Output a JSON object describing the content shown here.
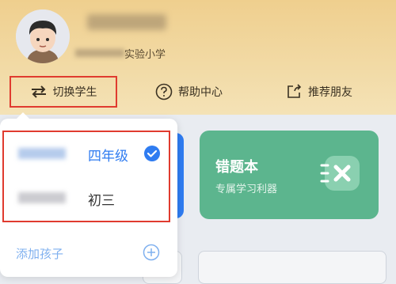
{
  "header": {
    "school_suffix": "实验小学",
    "actions": {
      "switch_label": "切换学生",
      "help_label": "帮助中心",
      "share_label": "推荐朋友"
    }
  },
  "cards": {
    "wrong_book": {
      "title": "错题本",
      "subtitle": "专属学习利器"
    }
  },
  "dropdown": {
    "students": [
      {
        "grade": "四年级",
        "selected": true
      },
      {
        "grade": "初三",
        "selected": false
      }
    ],
    "add_child_label": "添加孩子"
  },
  "colors": {
    "accent_blue": "#2f7cf1",
    "highlight_red": "#e03b2f",
    "card_green": "#5cb58e",
    "header_gold": "#efcf8e"
  },
  "icons": {
    "switch": "switch-arrows-icon",
    "help": "question-circle-icon",
    "share": "share-box-icon",
    "check": "check-circle-icon",
    "add": "plus-circle-icon",
    "card": "wrong-book-icon"
  }
}
